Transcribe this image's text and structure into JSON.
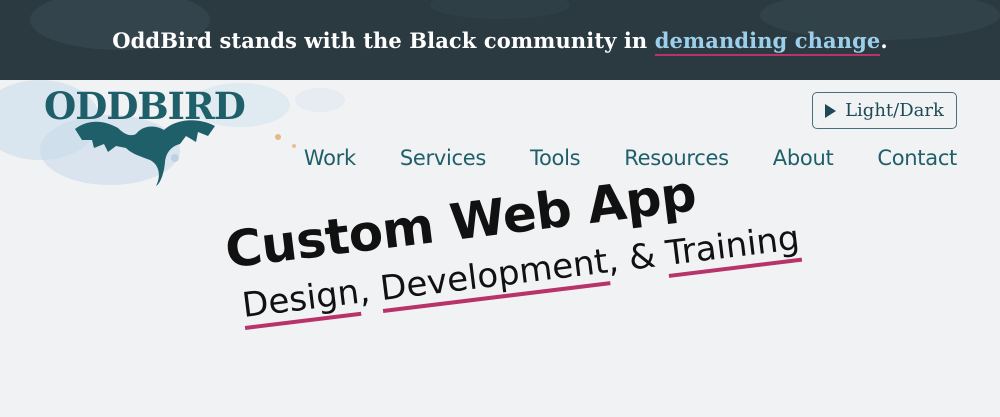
{
  "banner": {
    "prefix": "OddBird stands with the Black community in ",
    "link": "demanding change",
    "suffix": "."
  },
  "logo": {
    "text": "ODDBIRD"
  },
  "theme_toggle": {
    "label": "Light/Dark",
    "icon": "play-icon"
  },
  "nav": {
    "items": [
      {
        "label": "Work"
      },
      {
        "label": "Services"
      },
      {
        "label": "Tools"
      },
      {
        "label": "Resources"
      },
      {
        "label": "About"
      },
      {
        "label": "Contact"
      }
    ]
  },
  "hero": {
    "title": "Custom Web App",
    "sub": {
      "design": "Design",
      "sep1": ", ",
      "development": "Development",
      "sep2": ", & ",
      "training": "Training"
    }
  },
  "colors": {
    "banner_bg": "#2b3940",
    "link": "#9cd0ea",
    "accent": "#b8336a",
    "brand_teal": "#1f5f6a",
    "page_bg": "#f1f2f4"
  }
}
